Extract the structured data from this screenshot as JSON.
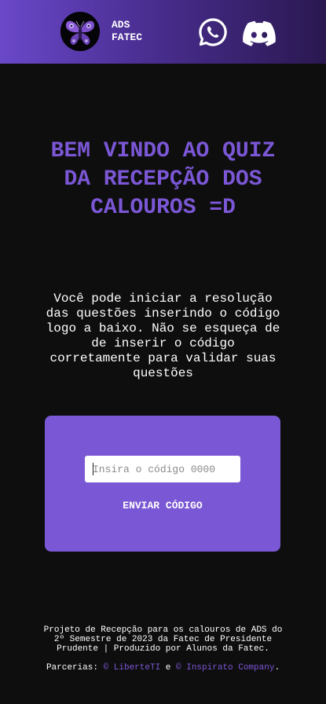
{
  "header": {
    "brand_line1": "ADS",
    "brand_line2": "FATEC",
    "logo_icon": "moth-logo-icon",
    "social": [
      {
        "name": "whatsapp",
        "icon": "whatsapp-icon"
      },
      {
        "name": "discord",
        "icon": "discord-icon"
      }
    ]
  },
  "hero": {
    "title": "BEM VINDO AO QUIZ DA RECEPÇÃO DOS CALOUROS =D",
    "description": "Você pode iniciar a resolução das questões inserindo o código logo a baixo. Não se esqueça de de inserir o código corretamente para validar suas questões"
  },
  "form": {
    "code_placeholder": "Insira o código 0000",
    "code_value": "",
    "submit_label": "ENVIAR CÓDIGO"
  },
  "footer": {
    "credits": "Projeto de Recepção para os calouros de ADS do 2º Semestre de 2023 da Fatec de Presidente Prudente | Produzido por Alunos da Fatec.",
    "partners_prefix": "Parcerias:",
    "partner1": "© LiberteTI",
    "separator": "e",
    "partner2": "© Inspirato Company",
    "suffix": "."
  },
  "colors": {
    "background": "#0e0e0e",
    "accent": "#7a57d4",
    "header_gradient_start": "#6a48c9",
    "header_gradient_end": "#2a1850",
    "text": "#ffffff"
  }
}
